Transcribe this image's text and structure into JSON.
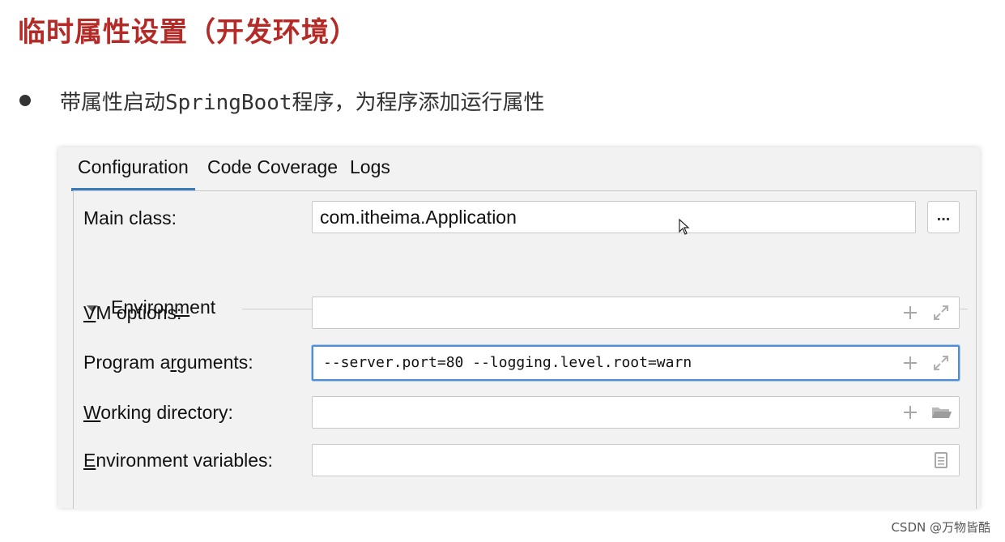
{
  "slide": {
    "title": "临时属性设置（开发环境）",
    "bullet": "带属性启动SpringBoot程序，为程序添加运行属性"
  },
  "tabs": [
    {
      "label": "Configuration",
      "active": true
    },
    {
      "label": "Code Coverage",
      "active": false
    },
    {
      "label": "Logs",
      "active": false
    }
  ],
  "main_class": {
    "label": "Main class:",
    "value": "com.itheima.Application",
    "browse_label": "..."
  },
  "environment_section": {
    "label_pre": "Environ",
    "label_mnemonic": "m",
    "label_post": "ent",
    "expanded": true
  },
  "vm_options": {
    "label_mnemonic": "V",
    "label_rest": "M options:",
    "value": ""
  },
  "program_arguments": {
    "label_pre": "Program a",
    "label_mnemonic": "r",
    "label_post": "guments:",
    "value": "--server.port=80 --logging.level.root=warn",
    "focused": true
  },
  "working_directory": {
    "label_mnemonic": "W",
    "label_rest": "orking directory:",
    "value": ""
  },
  "environment_variables": {
    "label_mnemonic": "E",
    "label_rest": "nvironment variables:",
    "value": ""
  },
  "icons": {
    "add": "plus-icon",
    "expand": "expand-icon",
    "folder": "folder-icon",
    "document": "document-icon",
    "collapse_arrow": "triangle-down-icon"
  },
  "colors": {
    "title": "#b32a26",
    "tab_underline": "#3d7ab8",
    "focus_border": "#4d8fd2",
    "dialog_bg": "#f2f2f2"
  },
  "watermark": "CSDN @万物皆酷"
}
